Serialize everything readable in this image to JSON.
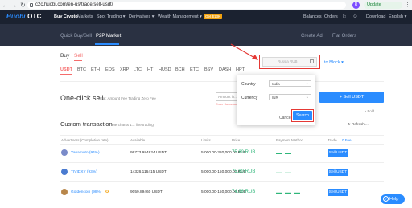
{
  "browser": {
    "url": "c2c.huobi.com/en-us/trade/sell-usdt/",
    "avatar": "R",
    "update_label": "Update"
  },
  "nav": {
    "logo_a": "Huobi",
    "logo_b": "OTC",
    "items": [
      "Buy Crypto",
      "Markets",
      "Spot Trading ▾",
      "Derivatives ▾",
      "Wealth Management ▾"
    ],
    "badge": "Get $13K",
    "right": [
      "Balances",
      "Orders",
      "Download",
      "English ▾"
    ]
  },
  "subnav": {
    "items": [
      "Quick Buy/Sell",
      "P2P Market"
    ],
    "right": [
      "Create Ad",
      "Fiat Orders"
    ]
  },
  "trade": {
    "buy": "Buy",
    "sell": "Sell",
    "coins": [
      "USDT",
      "BTC",
      "ETH",
      "EOS",
      "XRP",
      "LTC",
      "HT",
      "HUSD",
      "BCH",
      "ETC",
      "BSV",
      "DASH",
      "HPT"
    ],
    "amount_placeholder": "Russia   RUB",
    "to_block": "to Block ▾"
  },
  "popup": {
    "country_label": "Country",
    "country_value": "India",
    "currency_label": "Currency",
    "currency_value": "INR",
    "cancel": "Cancel",
    "search": "Search"
  },
  "oneclick": {
    "title": "One-click sell",
    "desc": "Deal: Amount   Fee Trading Zero Fee",
    "amount_placeholder": "Amount in...",
    "error": "Enter the amou...",
    "button": "+ Sell USDT",
    "fold": "▴ Fold"
  },
  "custom": {
    "title": "Custom transaction",
    "desc": "Merchants 1:1 line trading",
    "refresh": "↻ Refresh ...",
    "headers": [
      "Advertisers (Completion rate)",
      "Available",
      "Limits",
      "Price",
      "Payment Method",
      "Trade"
    ],
    "tips": "0 Fee",
    "rows": [
      {
        "name": "Yanamoto (94%)",
        "available": "99773.984824 USDT",
        "limits": "5,000.00-380,000.00 RUB",
        "price": "75.80 RUB",
        "pay": [
          "▬ ",
          "▬"
        ],
        "button": "Sell USDT",
        "avatar_color": "#7a8bc9"
      },
      {
        "name": "TIVIDXY (93%)",
        "available": "14326.116415 USDT",
        "limits": "5,000.00-150,000.00 RUB",
        "price": "75.80 RUB",
        "pay": [
          "▬ ",
          "▬"
        ],
        "button": "Sell USDT",
        "avatar_color": "#4a7bd0"
      },
      {
        "name": "Goldencoin (98%)",
        "available": "9059.89460 USDT",
        "limits": "5,000.00-150,000.00 RUB",
        "price": "74.96 RUB",
        "pay": [
          "▬ ",
          "▬",
          "▬"
        ],
        "button": "Sell USDT",
        "avatar_color": "#b8864a"
      }
    ]
  },
  "help": "Help",
  "colors": {
    "accent": "#2a8cff",
    "sell": "#f56c6c",
    "annotation": "#e53935",
    "price": "#2fb67a"
  }
}
